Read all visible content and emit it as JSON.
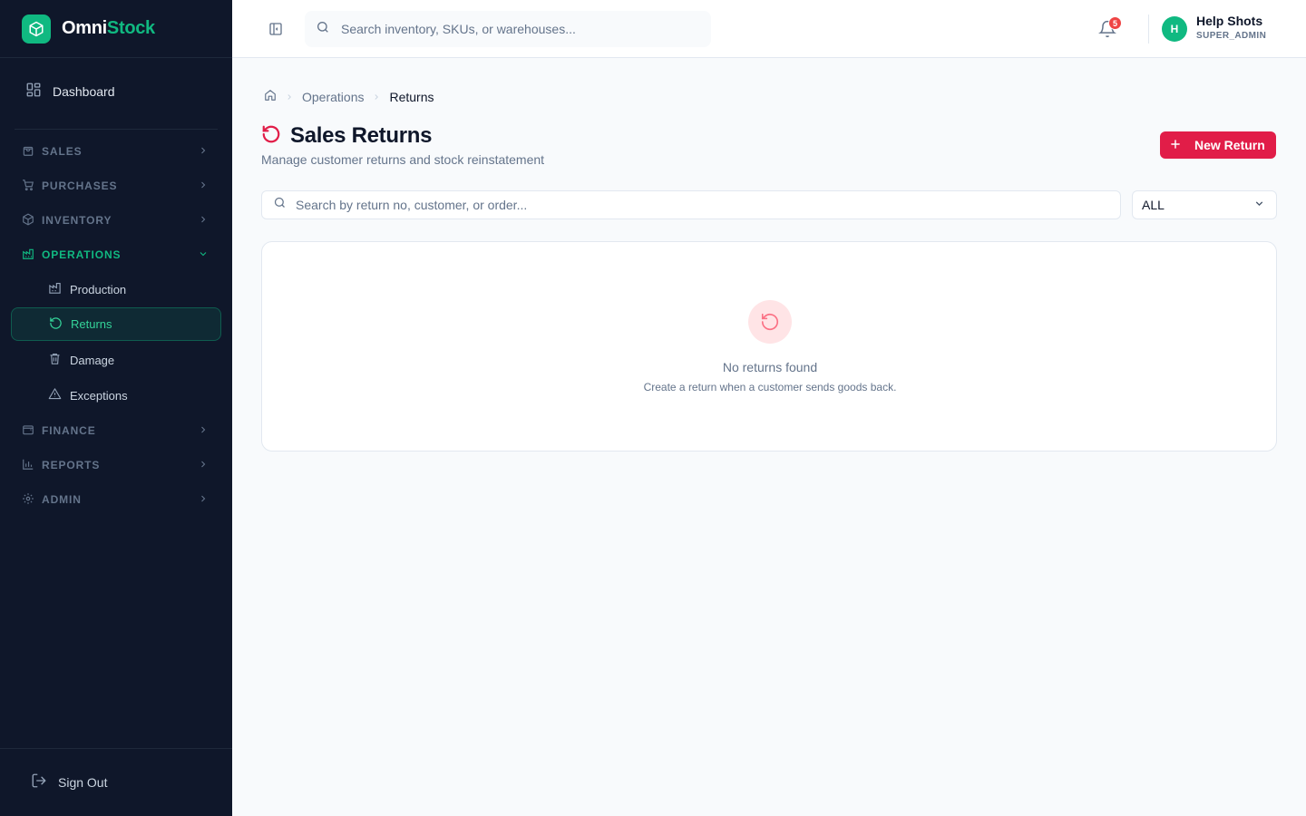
{
  "brand": {
    "name_part1": "Omni",
    "name_part2": "Stock",
    "accent": "#10b981"
  },
  "sidebar": {
    "dashboard_label": "Dashboard",
    "groups": [
      {
        "label": "SALES",
        "icon": "shopping-bag-icon",
        "expanded": false
      },
      {
        "label": "PURCHASES",
        "icon": "cart-icon",
        "expanded": false
      },
      {
        "label": "INVENTORY",
        "icon": "box-icon",
        "expanded": false
      },
      {
        "label": "OPERATIONS",
        "icon": "factory-icon",
        "expanded": true,
        "items": [
          {
            "label": "Production",
            "icon": "factory-icon"
          },
          {
            "label": "Returns",
            "icon": "rotate-ccw-icon",
            "active": true
          },
          {
            "label": "Damage",
            "icon": "trash-icon"
          },
          {
            "label": "Exceptions",
            "icon": "warning-icon"
          }
        ]
      },
      {
        "label": "FINANCE",
        "icon": "wallet-icon",
        "expanded": false
      },
      {
        "label": "REPORTS",
        "icon": "bar-chart-icon",
        "expanded": false
      },
      {
        "label": "ADMIN",
        "icon": "gear-icon",
        "expanded": false
      }
    ],
    "sign_out_label": "Sign Out"
  },
  "header": {
    "search_placeholder": "Search inventory, SKUs, or warehouses...",
    "notification_count": "5",
    "user": {
      "initial": "H",
      "name": "Help Shots",
      "role": "SUPER_ADMIN"
    }
  },
  "breadcrumb": {
    "parent": "Operations",
    "current": "Returns"
  },
  "page": {
    "title": "Sales Returns",
    "subtitle": "Manage customer returns and stock reinstatement",
    "new_button_label": "New Return",
    "accent": "#e11d48"
  },
  "filters": {
    "search_placeholder": "Search by return no, customer, or order...",
    "status_value": "ALL"
  },
  "empty_state": {
    "title": "No returns found",
    "description": "Create a return when a customer sends goods back."
  }
}
